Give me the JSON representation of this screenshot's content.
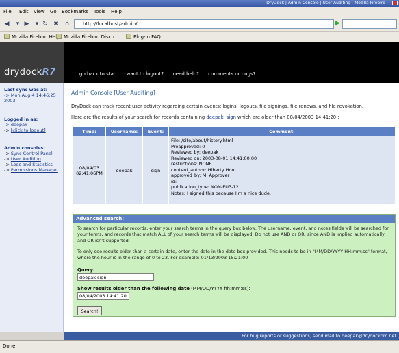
{
  "window": {
    "title": "DryDock | Admin Console | User Auditing - Mozilla Firebird"
  },
  "menu": [
    "File",
    "Edit",
    "View",
    "Go",
    "Bookmarks",
    "Tools",
    "Help"
  ],
  "nav": {
    "url": "http://localhost/admin/"
  },
  "bookmarks": [
    "Mozilla Firebird Help",
    "Mozilla Firebird Discu...",
    "Plug-in FAQ"
  ],
  "brand": {
    "name": "drydock",
    "version": "R7"
  },
  "topnav": [
    "go back to start",
    "want to logout?",
    "need help?",
    "comments or bugs?"
  ],
  "sidebar": {
    "last_sync_label": "Last sync was at:",
    "last_sync_value": "-> Mon Aug 4 14:46:25 2003",
    "logged_in_label": "Logged in as:",
    "logged_in_user": "-> deepak",
    "logout_link": "[click to logout]",
    "admin_label": "Admin consoles:",
    "consoles": [
      "Sync Control Panel",
      "User Auditing",
      "Logs and Statistics",
      "Permissions Manager"
    ]
  },
  "main": {
    "title": "Admin Console [User Auditing]",
    "intro": "DryDock can track recent user activity regarding certain events: logins, logouts, file signings, file renews, and file revokation.",
    "results_prefix": "Here are the results of your search for records containing ",
    "results_kw1": "deepak",
    "results_and": ", ",
    "results_kw2": "sign",
    "results_suffix": " which are older than 08/04/2003 14:41:20 :",
    "table": {
      "headers": [
        "Time:",
        "Username:",
        "Event:",
        "Comment:"
      ],
      "rows": [
        {
          "time": "08/04/03 02:41:06PM",
          "username": "deepak",
          "event": "sign",
          "comment": [
            "File: /site/about/history.html",
            "Preapproved: 0",
            "Reviewed by: deepak",
            "Reviewed on: 2003-08-01 14:41:00.00",
            "restrictions: NONE",
            "content_author: Hiberty Hoo",
            "approved_by: M. Approver",
            "id:",
            "publication_type: NON-EU3-12",
            "Notes: I signed this because I'm a nice dude."
          ]
        }
      ]
    }
  },
  "advanced": {
    "header": "Advanced search:",
    "para1": "To search for particular records, enter your search terms in the query box below. The username, event, and notes fields will be searched for your terms, and records that match ALL of your search terms will be displayed. Do not use AND or OR, since AND is implied automatically and OR isn't supported.",
    "para2": "To only see results older than a certain date, enter the date in the date box provided. This needs to be in \"MM/DD/YYYY HH:mm:ss\" format, where the hour is in the range of 0 to 23. For example: 01/13/2003 15:21:00",
    "query_label": "Query:",
    "query_value": "deepak sign",
    "date_label": "Show results older than the following date",
    "date_hint": " (MM/DD/YYYY hh:mm:ss):",
    "date_value": "08/04/2003 14:41:20",
    "search_button": "Search!"
  },
  "footer": "For bug reports or suggestions, send mail to deepak@drydockpro.net",
  "status": "Done"
}
